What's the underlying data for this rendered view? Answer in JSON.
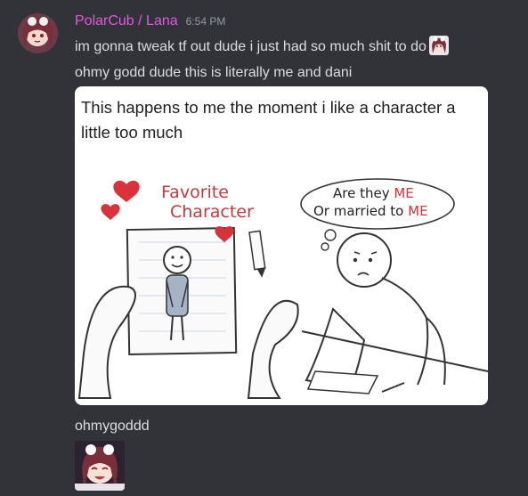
{
  "message": {
    "username": "PolarCub / Lana",
    "timestamp": "6:54 PM",
    "username_color": "#e556e0",
    "lines": [
      "im gonna tweak tf out dude i just had so much shit to do",
      "ohmy godd dude this is literally me and dani",
      "ohmygoddd"
    ],
    "inline_emoji": "anime-girl-emoji",
    "attachment": {
      "caption": "This happens to me the moment i like a character a little too much",
      "left_panel_label": "Favorite Character",
      "thought_bubble": "Are they ME Or married to ME",
      "thought_line1_a": "Are they ",
      "thought_line1_b": "ME",
      "thought_line2_a": "Or married to ",
      "thought_line2_b": "ME",
      "label_line1": "Favorite",
      "label_line2": "Character",
      "accent_color": "#d9323a"
    },
    "sticker": "anime-girl-sticker"
  }
}
